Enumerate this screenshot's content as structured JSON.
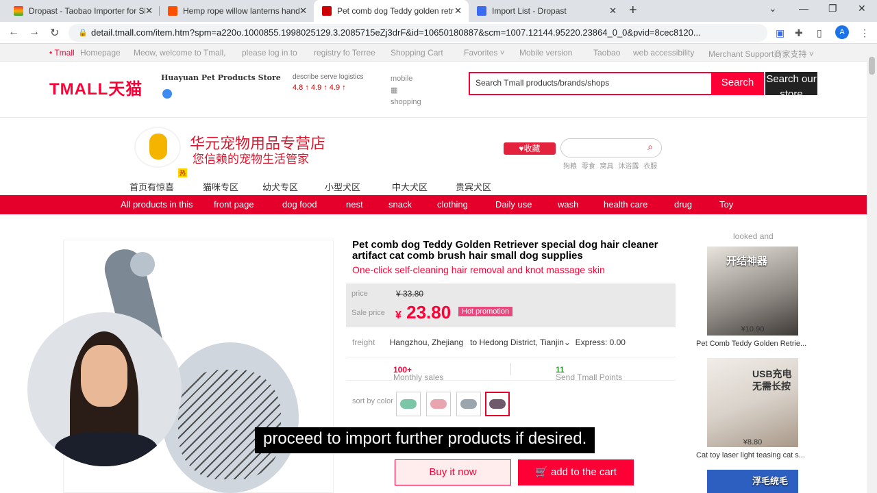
{
  "tabs": [
    {
      "title": "Dropast - Taobao Importer for Sh",
      "icon": "dropast-rainbow-icon"
    },
    {
      "title": "Hemp rope willow lanterns hand",
      "icon": "taobao-icon"
    },
    {
      "title": "Pet comb dog Teddy golden retri",
      "icon": "tmall-icon"
    },
    {
      "title": "Import List - Dropast",
      "icon": "dropast-icon"
    }
  ],
  "address": {
    "url": "detail.tmall.com/item.htm?spm=a220o.1000855.1998025129.3.2085715eZj3drF&id=10650180887&scm=1007.12144.95220.23864_0_0&pvid=8cec8120..."
  },
  "bookmarks": [
    "• Tmall",
    "Homepage",
    "Meow, welcome to Tmall,",
    "please log in to",
    "registry fo Terree",
    "Shopping Cart",
    "Favorites ˅",
    "Mobile version",
    "Taobao",
    "web accessibility",
    "Merchant Support商家支持 ˅"
  ],
  "header": {
    "logo": "TMALL天猫",
    "store": "Huayuan Pet Products Store",
    "ratings_labels": "describe serve logistics",
    "ratings_values": "4.8 ↑ 4.9 ↑ 4.9 ↑",
    "mobile": "mobile",
    "mobile2": "shopping",
    "search_placeholder": "Search Tmall products/brands/shops",
    "search_btn": "Search",
    "search_store": "Search our store"
  },
  "banner": {
    "store_cn": "华元宠物用品专营店",
    "slogan_cn": "您信赖的宠物生活管家",
    "fav_btn": "♥收藏",
    "hot_words": "狗粮 零食 窝具 沐浴露 衣服"
  },
  "shop_categories": [
    "首页有惊喜",
    "猫咪专区",
    "幼犬专区",
    "小型犬区",
    "中大犬区",
    "贵宾犬区"
  ],
  "nav": [
    "All products in this",
    "front page",
    "dog food",
    "nest",
    "snack",
    "clothing",
    "Daily use",
    "wash",
    "health care",
    "drug",
    "Toy"
  ],
  "product": {
    "title": "Pet comb dog Teddy Golden Retriever special dog hair cleaner artifact cat comb brush hair small dog supplies",
    "subtitle": "One-click self-cleaning hair removal and knot massage skin",
    "price_label": "price",
    "old_price": "¥ 33.80",
    "sale_label": "Sale price",
    "currency": "¥",
    "new_price": "23.80",
    "promo": "Hot promotion",
    "freight_label": "freight",
    "freight_from": "Hangzhou, Zhejiang",
    "freight_to": "to Hedong District, Tianjin",
    "express": "Express: 0.00",
    "monthly_label": "Monthly sales",
    "monthly_value": "100+",
    "points_label": "Send Tmall Points",
    "points_value": "11",
    "color_label": "sort by color",
    "buy_now": "Buy it now",
    "add_cart": "add to the cart"
  },
  "recommend": {
    "header": "looked and",
    "items": [
      {
        "img_text": "开结神器",
        "price": "¥10.90",
        "title": "Pet Comb Teddy Golden Retrie..."
      },
      {
        "img_text": "USB充电无需长按",
        "price": "¥8.80",
        "title": "Cat toy laser light teasing cat s..."
      },
      {
        "img_text": "浮毛统毛"
      }
    ]
  },
  "caption": "proceed to import further products if desired.",
  "colors": {
    "tmall_red": "#ff0036",
    "nav_red": "#e4002b"
  }
}
